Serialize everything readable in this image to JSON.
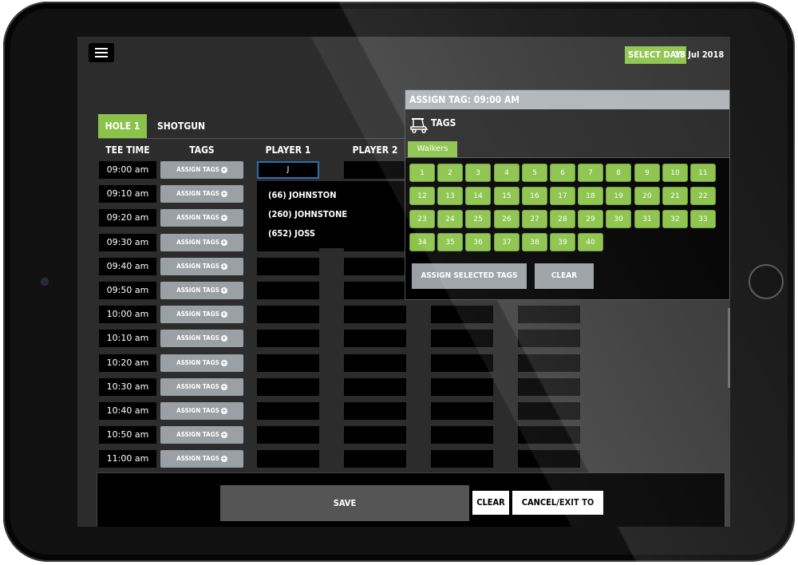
{
  "header": {
    "select_day_label": "SELECT DAY:",
    "selected_date": "18 Jul 2018"
  },
  "tabs": {
    "hole": "HOLE 1",
    "shotgun": "SHOTGUN"
  },
  "columns": {
    "tee_time": "TEE TIME",
    "tags": "TAGS",
    "player1": "PLAYER 1",
    "player2": "PLAYER 2"
  },
  "rows": [
    {
      "time": "09:00 am",
      "assign": "ASSIGN TAGS"
    },
    {
      "time": "09:10 am",
      "assign": "ASSIGN TAGS"
    },
    {
      "time": "09:20 am",
      "assign": "ASSIGN TAGS"
    },
    {
      "time": "09:30 am",
      "assign": "ASSIGN TAGS"
    },
    {
      "time": "09:40 am",
      "assign": "ASSIGN TAGS"
    },
    {
      "time": "09:50 am",
      "assign": "ASSIGN TAGS"
    },
    {
      "time": "10:00 am",
      "assign": "ASSIGN TAGS"
    },
    {
      "time": "10:10 am",
      "assign": "ASSIGN TAGS"
    },
    {
      "time": "10:20 am",
      "assign": "ASSIGN TAGS"
    },
    {
      "time": "10:30 am",
      "assign": "ASSIGN TAGS"
    },
    {
      "time": "10:40 am",
      "assign": "ASSIGN TAGS"
    },
    {
      "time": "10:50 am",
      "assign": "ASSIGN TAGS"
    },
    {
      "time": "11:00 am",
      "assign": "ASSIGN TAGS"
    }
  ],
  "player1_input": {
    "value": "J"
  },
  "autocomplete": [
    "(66) JOHNSTON",
    "(260) JOHNSTONE",
    "(652) JOSS"
  ],
  "assign_panel": {
    "title": "ASSIGN TAG: 09:00 AM",
    "tags_title": "TAGS",
    "category_tab": "Walkers",
    "tags": [
      "1",
      "2",
      "3",
      "4",
      "5",
      "6",
      "7",
      "8",
      "9",
      "10",
      "11",
      "12",
      "13",
      "14",
      "15",
      "16",
      "17",
      "18",
      "19",
      "20",
      "21",
      "22",
      "23",
      "24",
      "25",
      "26",
      "27",
      "28",
      "29",
      "30",
      "31",
      "32",
      "33",
      "34",
      "35",
      "36",
      "37",
      "38",
      "39",
      "40"
    ],
    "assign_button": "ASSIGN SELECTED TAGS",
    "clear_button": "CLEAR"
  },
  "footer": {
    "save": "SAVE",
    "clear": "CLEAR",
    "cancel": "CANCEL/EXIT TO MAP"
  },
  "colors": {
    "accent": "#8bc34a",
    "button_gray": "#9aa0a4",
    "cell_black": "#000000"
  },
  "icons": {
    "menu": "hamburger-menu-icon",
    "cart": "golf-cart-icon",
    "plus": "plus-circle-icon"
  }
}
